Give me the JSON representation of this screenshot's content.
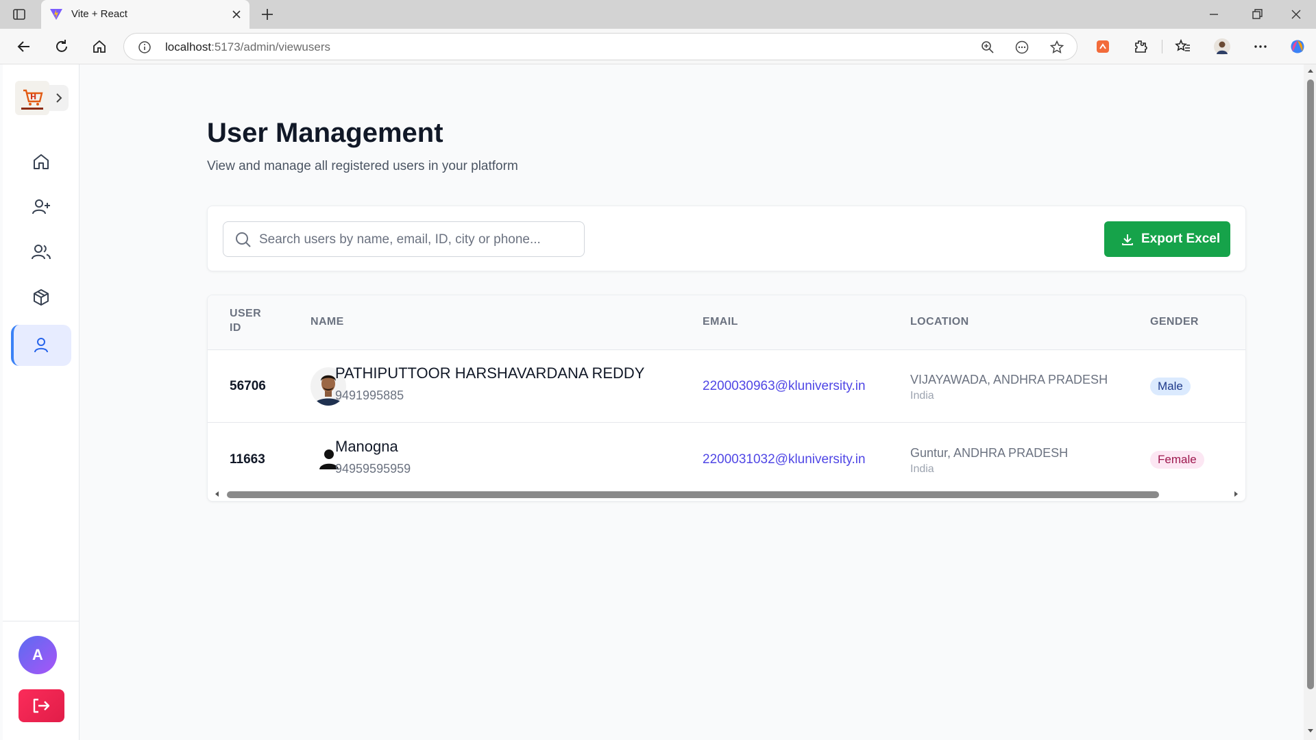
{
  "browser": {
    "tab_title": "Vite + React",
    "url_host": "localhost",
    "url_rest": ":5173/admin/viewusers"
  },
  "sidebar": {
    "items": [
      {
        "name": "home"
      },
      {
        "name": "add-user"
      },
      {
        "name": "users"
      },
      {
        "name": "products"
      },
      {
        "name": "profile",
        "active": true
      }
    ],
    "avatar_letter": "A"
  },
  "page": {
    "title": "User Management",
    "subtitle": "View and manage all registered users in your platform"
  },
  "search": {
    "placeholder": "Search users by name, email, ID, city or phone...",
    "value": ""
  },
  "toolbar": {
    "export_label": "Export Excel"
  },
  "table": {
    "headers": {
      "user_id_1": "USER",
      "user_id_2": "ID",
      "name": "NAME",
      "email": "EMAIL",
      "location": "LOCATION",
      "gender": "GENDER"
    },
    "rows": [
      {
        "id": "56706",
        "name": "PATHIPUTTOOR HARSHAVARDANA REDDY",
        "phone": "9491995885",
        "email": "2200030963@kluniversity.in",
        "city_state": "VIJAYAWADA, ANDHRA PRADESH",
        "country": "India",
        "gender": "Male"
      },
      {
        "id": "11663",
        "name": "Manogna",
        "phone": "94959595959",
        "email": "2200031032@kluniversity.in",
        "city_state": "Guntur, ANDHRA PRADESH",
        "country": "India",
        "gender": "Female"
      }
    ]
  },
  "colors": {
    "accent": "#3b82f6",
    "export_green": "#16a34a",
    "email_link": "#4f46e5",
    "logout_red": "#e11d48"
  }
}
